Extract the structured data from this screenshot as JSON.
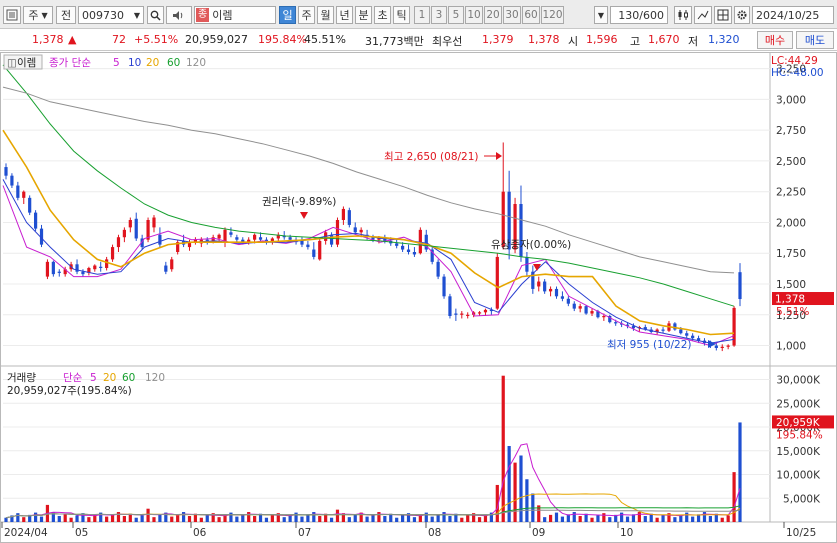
{
  "toolbar": {
    "type_label": "주",
    "market_label": "전",
    "code": "009730",
    "stock_tag": "종",
    "stock_name": "이렘",
    "periods": [
      "일",
      "주",
      "월",
      "년",
      "분",
      "초",
      "틱"
    ],
    "active_period": "일",
    "minutes": [
      "1",
      "3",
      "5",
      "10",
      "20",
      "30",
      "60",
      "120"
    ],
    "count": "130",
    "count_total": "/600",
    "date": "2024/10/25"
  },
  "quote": {
    "price": "1,378",
    "arrow": "▲",
    "change": "72",
    "change_pct": "+5.51%",
    "volume": "20,959,027",
    "volume_ratio": "195.84%",
    "turnover": "45.51%",
    "amount": "31,773백만",
    "pref_label": "최우선",
    "pref_ask": "1,379",
    "pref_bid": "1,378",
    "open_label": "시",
    "open": "1,596",
    "high_label": "고",
    "high": "1,670",
    "low_label": "저",
    "low": "1,320",
    "buy_label": "매수",
    "sell_label": "매도"
  },
  "chart_panel": {
    "name_label": "이렘",
    "legend_prefix": "종가 단순",
    "ma_periods": [
      "5",
      "10",
      "20",
      "60",
      "120"
    ],
    "lc_label": "LC:44.29",
    "hc_label": "HC:-48.00",
    "max_annotation": "최고 2,650 (08/21)",
    "min_annotation": "최저 955 (10/22)",
    "event_rights": "권리락(-9.89%)",
    "event_capital": "유상증자(0.00%)",
    "last_price": "1,378",
    "last_pct": "5.51%"
  },
  "volume_panel": {
    "label": "거래량",
    "legend_prefix": "단순",
    "ma_periods": [
      "5",
      "20",
      "60",
      "120"
    ],
    "current": "20,959,027주(195.84%)",
    "last_value": "20,959K",
    "last_pct": "195.84%"
  },
  "x_labels": [
    "2024/04",
    "05",
    "06",
    "07",
    "08",
    "09",
    "10",
    "10/25"
  ],
  "colors": {
    "up": "#e0141e",
    "down": "#1f4fd1",
    "ma5": "#c81ed0",
    "ma10": "#2a3fd0",
    "ma20": "#e6a600",
    "ma60": "#18a030",
    "ma120": "#909090",
    "active_tab": "#3f86d6"
  },
  "chart_data": {
    "type": "candlestick",
    "y_axis_ticks": [
      "3,250",
      "3,000",
      "2,750",
      "2,500",
      "2,250",
      "2,000",
      "1,750",
      "1,500",
      "1,250",
      "1,000"
    ],
    "ylim": [
      850,
      3320
    ],
    "volume_axis_ticks": [
      "30,000K",
      "25,000K",
      "20,000K",
      "15,000K",
      "10,000K",
      "5,000K"
    ],
    "volume_ylim": [
      0,
      32000
    ],
    "x_axis_labels": [
      "2024/04",
      "05",
      "06",
      "07",
      "08",
      "09",
      "10",
      "10/25"
    ],
    "series": [
      {
        "name": "5",
        "values": [
          2300,
          1800,
          1720,
          1560,
          1560,
          1620,
          1870,
          1930,
          1860,
          1870,
          1820,
          1850,
          1830,
          1870,
          1960,
          1900,
          1840,
          1880,
          1800,
          1600,
          1240,
          1250,
          1650,
          1700,
          1400,
          1300,
          1200,
          1110,
          1080,
          1050,
          1000,
          1080
        ]
      },
      {
        "name": "10",
        "values": [
          2350,
          2000,
          1800,
          1620,
          1580,
          1600,
          1800,
          1870,
          1840,
          1850,
          1830,
          1840,
          1840,
          1860,
          1900,
          1910,
          1870,
          1860,
          1830,
          1700,
          1350,
          1270,
          1500,
          1680,
          1500,
          1350,
          1230,
          1140,
          1100,
          1060,
          1020,
          1050
        ]
      },
      {
        "name": "20",
        "values": [
          2750,
          2450,
          2100,
          1860,
          1700,
          1640,
          1750,
          1820,
          1840,
          1840,
          1840,
          1840,
          1850,
          1860,
          1880,
          1890,
          1880,
          1860,
          1820,
          1750,
          1590,
          1470,
          1560,
          1580,
          1560,
          1560,
          1320,
          1200,
          1160,
          1130,
          1090,
          1100
        ]
      },
      {
        "name": "60",
        "values": [
          3280,
          3050,
          2800,
          2580,
          2420,
          2280,
          2150,
          2060,
          2000,
          1960,
          1930,
          1910,
          1890,
          1880,
          1870,
          1860,
          1850,
          1830,
          1810,
          1790,
          1770,
          1750,
          1720,
          1700,
          1670,
          1630,
          1590,
          1550,
          1500,
          1440,
          1380,
          1320
        ]
      },
      {
        "name": "120",
        "values": [
          3100,
          3050,
          2980,
          2940,
          2900,
          2860,
          2820,
          2790,
          2750,
          2720,
          2680,
          2640,
          2590,
          2540,
          2480,
          2410,
          2350,
          2290,
          2220,
          2160,
          2110,
          2070,
          2020,
          1970,
          1900,
          1840,
          1780,
          1720,
          1680,
          1640,
          1600,
          1590
        ]
      }
    ],
    "annotations": [
      {
        "text": "최고 2,650 (08/21)",
        "value": 2650
      },
      {
        "text": "최저 955 (10/22)",
        "value": 955
      },
      {
        "text": "권리락(-9.89%)"
      },
      {
        "text": "유상증자(0.00%)"
      }
    ],
    "last_price": 1378,
    "last_volume_k": 20959
  }
}
